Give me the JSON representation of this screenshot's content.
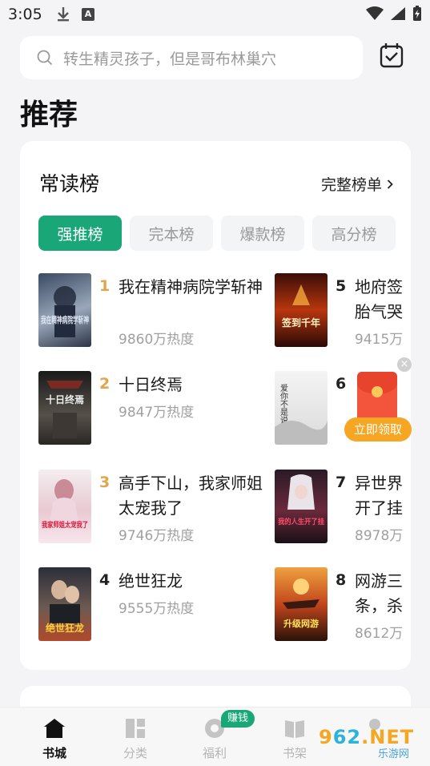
{
  "status_bar": {
    "time": "3:05"
  },
  "search": {
    "placeholder": "转生精灵孩子，但是哥布林巢穴"
  },
  "page": {
    "title": "推荐"
  },
  "ranking": {
    "title": "常读榜",
    "full_list_label": "完整榜单",
    "tabs": [
      "强推榜",
      "完本榜",
      "爆款榜",
      "高分榜"
    ],
    "active_tab": 0,
    "books": [
      {
        "rank": "1",
        "title": "我在精神病院学斩神",
        "heat": "9860万热度",
        "cover_text": "我在精神病院学斩神"
      },
      {
        "rank": "2",
        "title": "十日终焉",
        "heat": "9847万热度",
        "cover_text": "十日终焉"
      },
      {
        "rank": "3",
        "title": "高手下山，我家师姐太宠我了",
        "heat": "9746万热度",
        "cover_text": "我家师姐太宠我了"
      },
      {
        "rank": "4",
        "title": "绝世狂龙",
        "heat": "9555万热度",
        "cover_text": "绝世狂龙"
      },
      {
        "rank": "5",
        "title": "地府签",
        "title2": "胎气哭",
        "heat": "9415万",
        "cover_text": "签到千年"
      },
      {
        "rank": "6",
        "title": "",
        "heat": "",
        "cover_text": "爱你不是说 说而已"
      },
      {
        "rank": "7",
        "title": "异世界",
        "title2": "开了挂",
        "heat": "8978万",
        "cover_text": "我的人生开了挂"
      },
      {
        "rank": "8",
        "title": "网游三",
        "title2": "条，杀",
        "heat": "8612万",
        "cover_text": "升级网游"
      }
    ],
    "rank_colors": {
      "top": "#e3a54a",
      "normal": "#222222"
    }
  },
  "promo": {
    "close": "×",
    "button": "立即领取"
  },
  "bottom_nav": {
    "items": [
      {
        "label": "书城"
      },
      {
        "label": "分类"
      },
      {
        "label": "福利"
      },
      {
        "label": "书架"
      },
      {
        "label": ""
      }
    ],
    "earn_badge": "赚钱"
  },
  "watermark": {
    "main_a": "9",
    "main_b": "62",
    "main_c": ".NET",
    "sub": "乐游网"
  },
  "colors": {
    "accent": "#19a778",
    "background": "#f4f4f6"
  }
}
